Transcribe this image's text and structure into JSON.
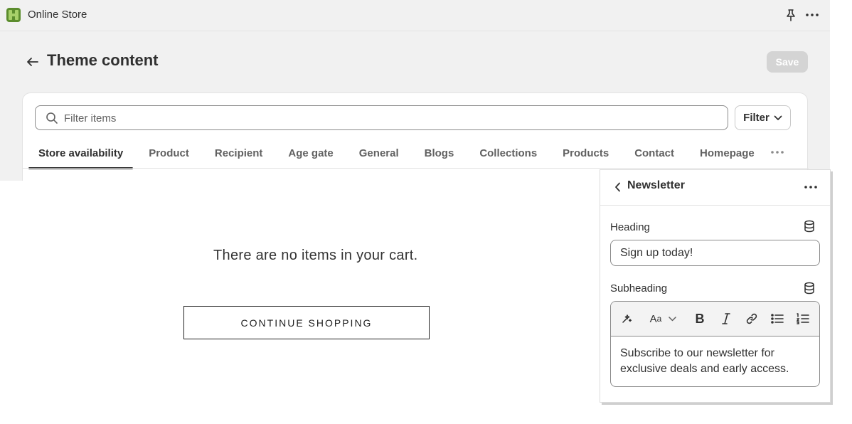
{
  "topbar": {
    "app_title": "Online Store",
    "icons": {
      "logo": "online-store-logo-icon",
      "pin": "pin-icon",
      "more": "more-horizontal-icon"
    }
  },
  "page": {
    "title": "Theme content",
    "save_label": "Save",
    "back_icon": "arrow-left-icon"
  },
  "filter_bar": {
    "search_placeholder": "Filter items",
    "search_value": "",
    "filter_label": "Filter"
  },
  "tabs": [
    {
      "label": "Store availability",
      "active": true
    },
    {
      "label": "Product",
      "active": false
    },
    {
      "label": "Recipient",
      "active": false
    },
    {
      "label": "Age gate",
      "active": false
    },
    {
      "label": "General",
      "active": false
    },
    {
      "label": "Blogs",
      "active": false
    },
    {
      "label": "Collections",
      "active": false
    },
    {
      "label": "Products",
      "active": false
    },
    {
      "label": "Contact",
      "active": false
    },
    {
      "label": "Homepage",
      "active": false
    }
  ],
  "preview": {
    "empty_cart_text": "There are no items in your cart.",
    "continue_label": "CONTINUE SHOPPING"
  },
  "editor": {
    "title": "Newsletter",
    "heading_label": "Heading",
    "heading_value": "Sign up today!",
    "subheading_label": "Subheading",
    "subheading_value": "Subscribe to our newsletter for exclusive deals and early access.",
    "toolbar_icons": [
      "magic-icon",
      "font-size-icon",
      "chevron-down-icon",
      "bold-icon",
      "italic-icon",
      "link-icon",
      "bullet-list-icon",
      "numbered-list-icon"
    ]
  },
  "colors": {
    "admin_bg": "#f1f1f1",
    "text_primary": "#303030",
    "text_secondary": "#616161",
    "save_disabled": "#d4d4d4",
    "logo_green": "#5c8d2e"
  }
}
